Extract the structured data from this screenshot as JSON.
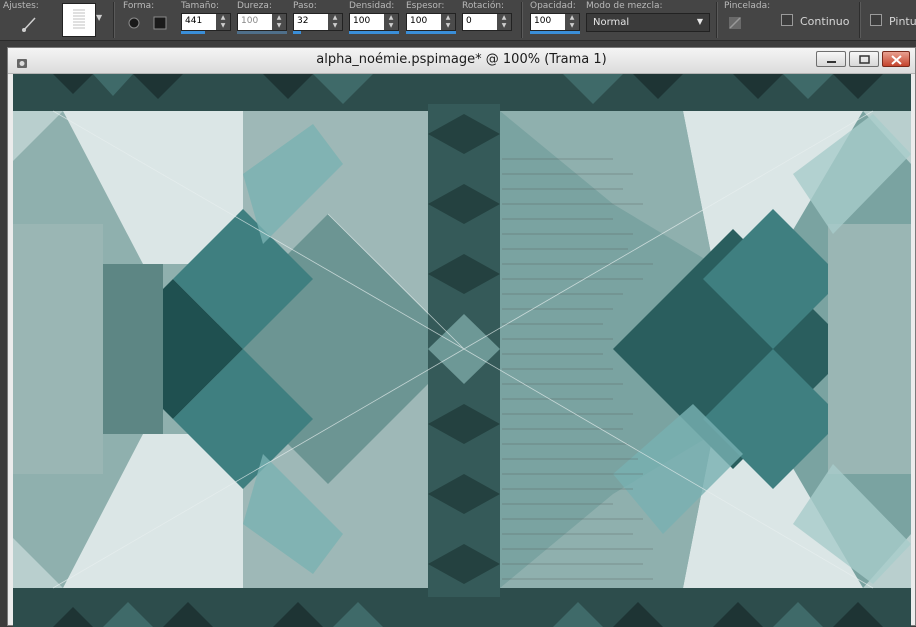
{
  "toolbar": {
    "ajustes_label": "Ajustes:",
    "forma_label": "Forma:",
    "tamano_label": "Tamaño:",
    "tamano_value": "441",
    "dureza_label": "Dureza:",
    "dureza_value": "100",
    "paso_label": "Paso:",
    "paso_value": "32",
    "densidad_label": "Densidad:",
    "densidad_value": "100",
    "espesor_label": "Espesor:",
    "espesor_value": "100",
    "rotacion_label": "Rotación:",
    "rotacion_value": "0",
    "opacidad_label": "Opacidad:",
    "opacidad_value": "100",
    "modo_label": "Modo de mezcla:",
    "modo_value": "Normal",
    "pincelada_label": "Pincelada:",
    "continuo_label": "Continuo",
    "pintura_label": "Pintur"
  },
  "window": {
    "title": "alpha_noémie.pspimage* @ 100% (Trama 1)"
  },
  "colors": {
    "toolbar_bg": "#454545",
    "accent": "#3a8ed8",
    "teal_dark": "#1f4f4f",
    "teal_mid": "#5e8e8c",
    "teal_light": "#a9c9c8",
    "pale": "#dbe6e6"
  }
}
